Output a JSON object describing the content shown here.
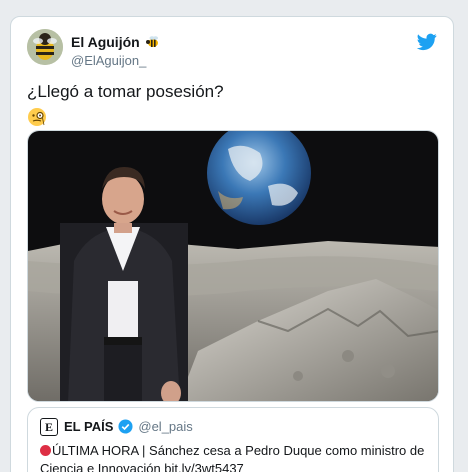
{
  "tweet": {
    "display_name": "El Aguijón",
    "handle": "@ElAguijon_",
    "text": "¿Llegó a tomar posesión?",
    "emoji_name_badge": "honeybee-icon",
    "emoji_after_text": "monocle-face-icon"
  },
  "media": {
    "subject": "photo-man-suit-moon-earth-backdrop"
  },
  "quoted_tweet": {
    "display_name": "EL PAÍS",
    "logo_letter": "E",
    "handle": "@el_pais",
    "verified_icon": "verified-badge-icon",
    "bullet_icon": "red-circle-icon",
    "text_line1": "ÚLTIMA HORA | Sánchez cesa a Pedro Duque como ministro de",
    "text_line2": "Ciencia e Innovación bit.ly/3wt5437"
  },
  "brand": {
    "logo": "twitter-bird-icon",
    "accent": "#1da1f2"
  }
}
